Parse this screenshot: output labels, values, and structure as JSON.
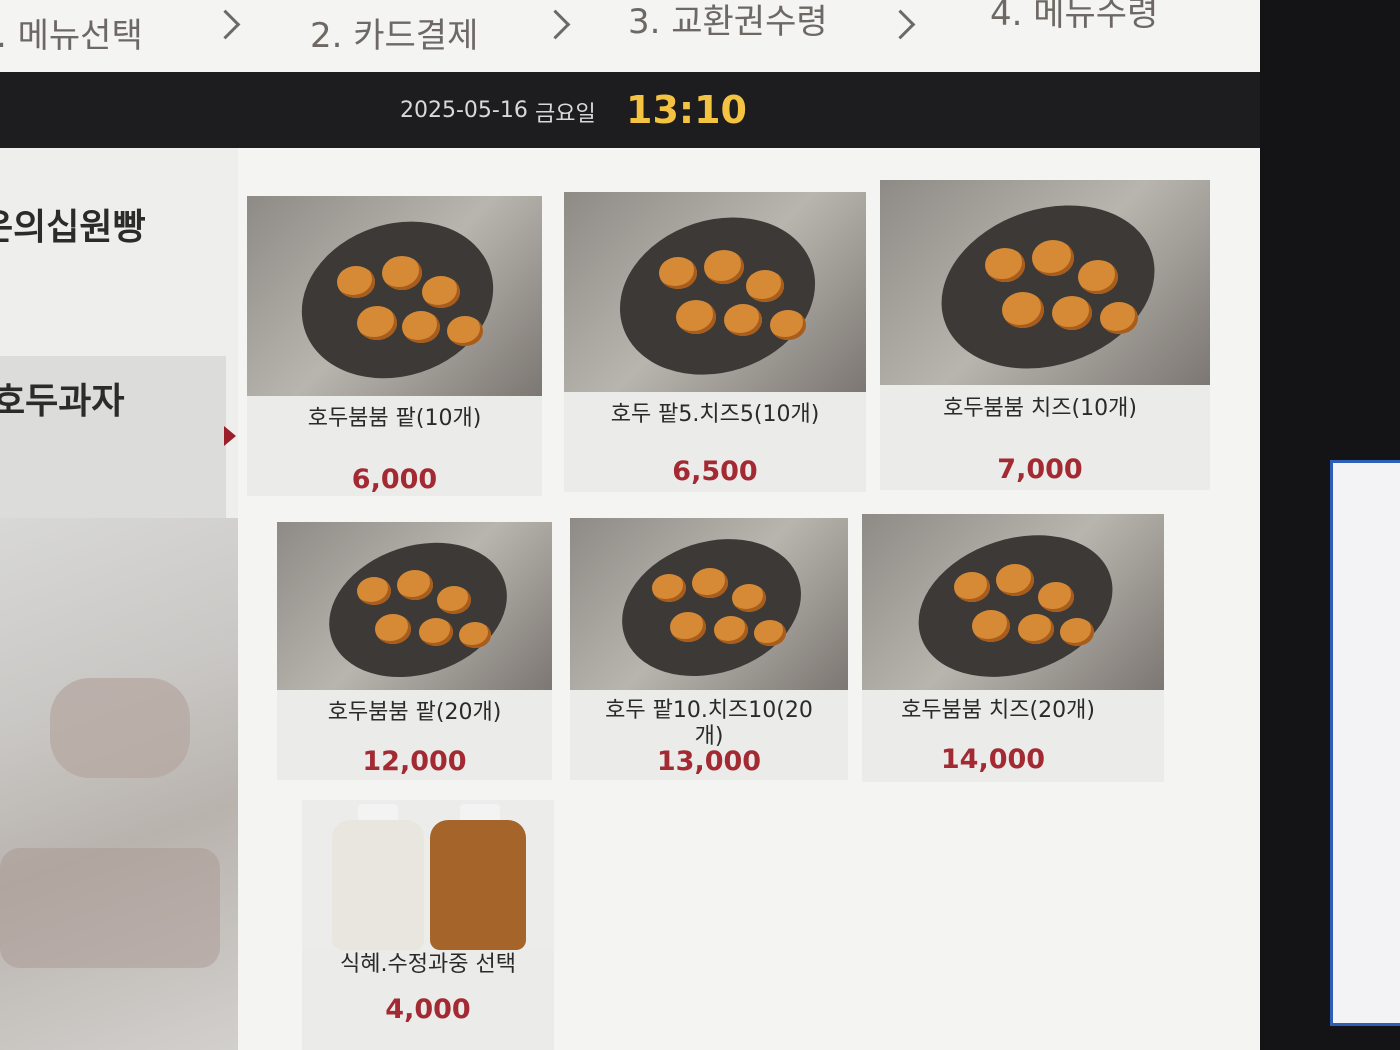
{
  "steps": [
    {
      "label": ". 메뉴선택"
    },
    {
      "label": "2. 카드결제"
    },
    {
      "label": "3. 교환권수령"
    },
    {
      "label": "4. 메뉴수령"
    }
  ],
  "header": {
    "date": "2025-05-16",
    "day": "금요일",
    "time": "13:10"
  },
  "sidebar": {
    "categories": [
      {
        "label": "은의십원빵"
      },
      {
        "label": "호두과자"
      }
    ]
  },
  "menu": [
    {
      "name": "호두붐붐 팥(10개)",
      "price": "6,000",
      "icon": "walnut-cakes-photo"
    },
    {
      "name": "호두 팥5.치즈5(10개)",
      "price": "6,500",
      "icon": "walnut-cakes-photo"
    },
    {
      "name": "호두붐붐 치즈(10개)",
      "price": "7,000",
      "icon": "walnut-cakes-photo"
    },
    {
      "name": "호두붐붐 팥(20개)",
      "price": "12,000",
      "icon": "walnut-cakes-photo"
    },
    {
      "name": "호두 팥10.치즈10(20개)",
      "price": "13,000",
      "icon": "walnut-cakes-photo"
    },
    {
      "name": "호두붐붐 치즈(20개)",
      "price": "14,000",
      "icon": "walnut-cakes-photo"
    },
    {
      "name": "식혜.수정과중 선택",
      "price": "4,000",
      "icon": "drink-bottles-photo"
    }
  ],
  "colors": {
    "price": "#a32a32",
    "time": "#f4c341",
    "header_bg": "#1d1d20",
    "selected_arrow": "#9a1f2a"
  }
}
